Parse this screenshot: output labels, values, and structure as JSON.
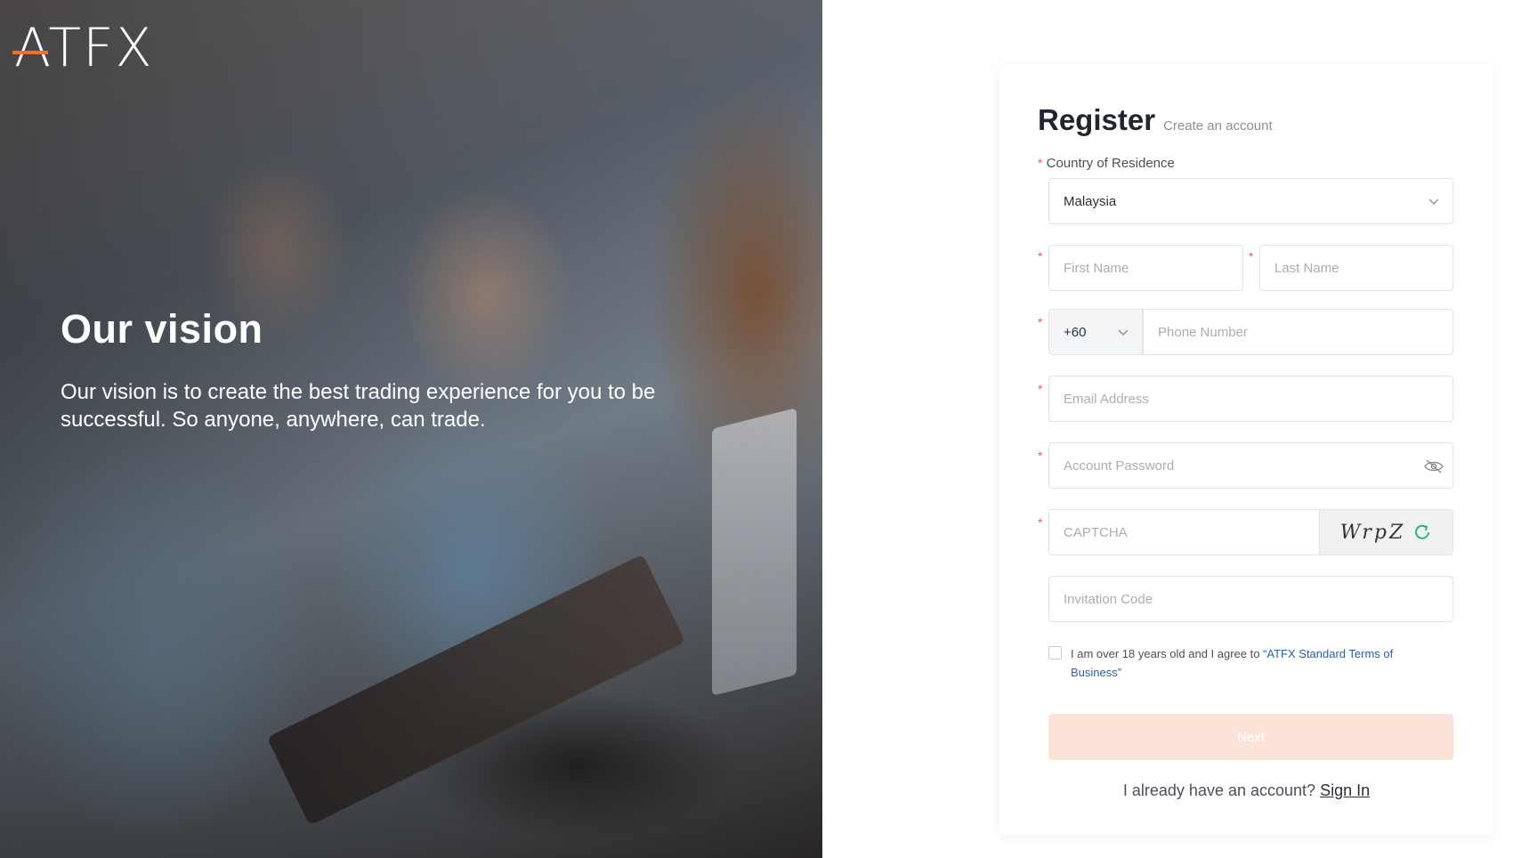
{
  "brand": {
    "logo_text": "ATFX",
    "accent_color": "#ef6d2d"
  },
  "hero": {
    "title": "Our vision",
    "text": "Our vision is to create the best trading experience for you to be successful. So anyone, anywhere, can trade."
  },
  "form": {
    "title": "Register",
    "subtitle": "Create an account",
    "required_marker": "*",
    "country_label": "Country of Residence",
    "country_value": "Malaysia",
    "first_name_placeholder": "First Name",
    "last_name_placeholder": "Last Name",
    "phone_code": "+60",
    "phone_placeholder": "Phone Number",
    "email_placeholder": "Email Address",
    "password_placeholder": "Account Password",
    "captcha_placeholder": "CAPTCHA",
    "captcha_image_text": "WrpZ",
    "invitation_placeholder": "Invitation Code",
    "terms_text": "I am over 18 years old and I agree to ",
    "terms_link": "“ATFX Standard Terms of Business”",
    "next_label": "Next",
    "signin_prompt": "I already have an account?",
    "signin_link": "Sign In",
    "icons": {
      "country_chevron": "chevron-down-icon",
      "phone_chevron": "chevron-down-icon",
      "password_toggle": "eye-off-icon",
      "captcha_refresh": "refresh-icon"
    }
  }
}
